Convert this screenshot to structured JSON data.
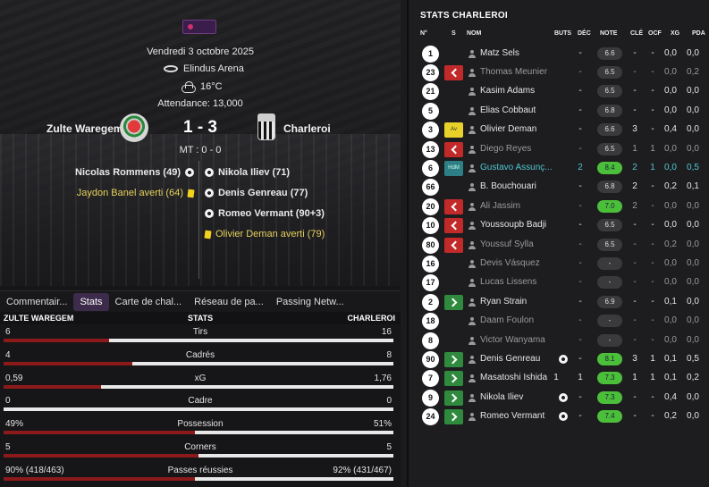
{
  "match": {
    "date": "Vendredi 3 octobre 2025",
    "stadium": "Elindus Arena",
    "weather": "16°C",
    "attendance": "Attendance: 13,000",
    "home_team": "Zulte Waregem",
    "away_team": "Charleroi",
    "score": "1 - 3",
    "halftime": "MT : 0 - 0"
  },
  "events": {
    "home": [
      {
        "text": "Nicolas Rommens (49)",
        "icon": "ball-icon"
      },
      {
        "text": "Jaydon Banel averti (64)",
        "icon": "yellow-card-icon"
      }
    ],
    "away": [
      {
        "text": "Nikola Iliev (71)",
        "icon": "ball-icon"
      },
      {
        "text": "Denis Genreau (77)",
        "icon": "ball-icon"
      },
      {
        "text": "Romeo Vermant (90+3)",
        "icon": "ball-icon"
      },
      {
        "text": "Olivier Deman averti (79)",
        "icon": "yellow-card-icon"
      }
    ]
  },
  "tabs": [
    "Commentair...",
    "Stats",
    "Carte de chal...",
    "Réseau de pa...",
    "Passing Netw..."
  ],
  "active_tab": "Stats",
  "stats": {
    "home_label": "ZULTE WAREGEM",
    "center_label": "STATS",
    "away_label": "CHARLEROI",
    "rows": [
      {
        "label": "Tirs",
        "home": "6",
        "away": "16",
        "home_share": 0.27
      },
      {
        "label": "Cadrés",
        "home": "4",
        "away": "8",
        "home_share": 0.33
      },
      {
        "label": "xG",
        "home": "0,59",
        "away": "1,76",
        "home_share": 0.25
      },
      {
        "label": "Cadre",
        "home": "0",
        "away": "0",
        "home_share": 0.0
      },
      {
        "label": "Possession",
        "home": "49%",
        "away": "51%",
        "home_share": 0.49
      },
      {
        "label": "Corners",
        "home": "5",
        "away": "5",
        "home_share": 0.5
      },
      {
        "label": "Passes réussies",
        "home": "90% (418/463)",
        "away": "92% (431/467)",
        "home_share": 0.49
      }
    ]
  },
  "squad": {
    "title": "STATS CHARLEROI",
    "columns": {
      "num": "N°",
      "s": "S",
      "name": "NOM",
      "buts": "BUTS",
      "dec": "DÉC",
      "note": "NOTE",
      "cle": "CLÉ",
      "ocf": "OCF",
      "xg": "XG",
      "pda": "PDA"
    },
    "players": [
      {
        "num": "1",
        "status": "",
        "name": "Matz Sels",
        "dim": false,
        "buts": "",
        "dec": "-",
        "note": "6.6",
        "green": false,
        "cle": "-",
        "ocf": "-",
        "xg": "0,0",
        "pda": "0,0",
        "goal": false
      },
      {
        "num": "23",
        "status": "out",
        "name": "Thomas Meunier",
        "dim": true,
        "buts": "",
        "dec": "-",
        "note": "6.5",
        "green": false,
        "cle": "-",
        "ocf": "-",
        "xg": "0,0",
        "pda": "0,2",
        "goal": false
      },
      {
        "num": "21",
        "status": "",
        "name": "Kasim Adams",
        "dim": false,
        "buts": "",
        "dec": "-",
        "note": "6.5",
        "green": false,
        "cle": "-",
        "ocf": "-",
        "xg": "0,0",
        "pda": "0,0",
        "goal": false
      },
      {
        "num": "5",
        "status": "",
        "name": "Elias Cobbaut",
        "dim": false,
        "buts": "",
        "dec": "-",
        "note": "6.8",
        "green": false,
        "cle": "-",
        "ocf": "-",
        "xg": "0,0",
        "pda": "0,0",
        "goal": false
      },
      {
        "num": "3",
        "status": "av",
        "status_text": "Av",
        "name": "Olivier Deman",
        "dim": false,
        "buts": "",
        "dec": "-",
        "note": "6.6",
        "green": false,
        "cle": "3",
        "ocf": "-",
        "xg": "0,4",
        "pda": "0,0",
        "goal": false
      },
      {
        "num": "13",
        "status": "out",
        "name": "Diego Reyes",
        "dim": true,
        "buts": "",
        "dec": "-",
        "note": "6.5",
        "green": false,
        "cle": "1",
        "ocf": "1",
        "xg": "0,0",
        "pda": "0,0",
        "goal": false
      },
      {
        "num": "6",
        "status": "hdm",
        "status_text": "HdM",
        "name": "Gustavo Assunç...",
        "hl": true,
        "buts": "",
        "dec": "2",
        "note": "8.4",
        "green": true,
        "cle": "2",
        "ocf": "1",
        "xg": "0,0",
        "pda": "0,5",
        "goal": false
      },
      {
        "num": "66",
        "status": "",
        "name": "B. Bouchouari",
        "dim": false,
        "buts": "",
        "dec": "-",
        "note": "6.8",
        "green": false,
        "cle": "2",
        "ocf": "-",
        "xg": "0,2",
        "pda": "0,1",
        "goal": false
      },
      {
        "num": "20",
        "status": "out",
        "name": "Ali Jassim",
        "dim": true,
        "buts": "",
        "dec": "-",
        "note": "7.0",
        "green": true,
        "cle": "2",
        "ocf": "-",
        "xg": "0,0",
        "pda": "0,0",
        "goal": false
      },
      {
        "num": "10",
        "status": "out",
        "name": "Youssoupb Badji",
        "dim": false,
        "buts": "",
        "dec": "-",
        "note": "6.5",
        "green": false,
        "cle": "-",
        "ocf": "-",
        "xg": "0,0",
        "pda": "0,0",
        "goal": false
      },
      {
        "num": "80",
        "status": "out",
        "name": "Youssuf Sylla",
        "dim": true,
        "buts": "",
        "dec": "-",
        "note": "6.5",
        "green": false,
        "cle": "-",
        "ocf": "-",
        "xg": "0,2",
        "pda": "0,0",
        "goal": false
      },
      {
        "num": "16",
        "status": "",
        "name": "Devis Vásquez",
        "dim": true,
        "buts": "",
        "dec": "-",
        "note": "-",
        "green": false,
        "cle": "-",
        "ocf": "-",
        "xg": "0,0",
        "pda": "0,0",
        "goal": false
      },
      {
        "num": "17",
        "status": "",
        "name": "Lucas Lissens",
        "dim": true,
        "buts": "",
        "dec": "-",
        "note": "-",
        "green": false,
        "cle": "-",
        "ocf": "-",
        "xg": "0,0",
        "pda": "0,0",
        "goal": false
      },
      {
        "num": "2",
        "status": "in",
        "name": "Ryan Strain",
        "dim": false,
        "buts": "",
        "dec": "-",
        "note": "6.9",
        "green": false,
        "cle": "-",
        "ocf": "-",
        "xg": "0,1",
        "pda": "0,0",
        "goal": false
      },
      {
        "num": "18",
        "status": "",
        "name": "Daam Foulon",
        "dim": true,
        "buts": "",
        "dec": "-",
        "note": "-",
        "green": false,
        "cle": "-",
        "ocf": "-",
        "xg": "0,0",
        "pda": "0,0",
        "goal": false
      },
      {
        "num": "8",
        "status": "",
        "name": "Victor Wanyama",
        "dim": true,
        "buts": "",
        "dec": "-",
        "note": "-",
        "green": false,
        "cle": "-",
        "ocf": "-",
        "xg": "0,0",
        "pda": "0,0",
        "goal": false
      },
      {
        "num": "90",
        "status": "in",
        "name": "Denis Genreau",
        "dim": false,
        "buts": "",
        "dec": "-",
        "note": "8.1",
        "green": true,
        "cle": "3",
        "ocf": "1",
        "xg": "0,1",
        "pda": "0,5",
        "goal": true
      },
      {
        "num": "7",
        "status": "in",
        "name": "Masatoshi Ishida",
        "dim": false,
        "buts": "1",
        "dec": "1",
        "note": "7.3",
        "green": true,
        "cle": "1",
        "ocf": "1",
        "xg": "0,1",
        "pda": "0,2",
        "goal": false
      },
      {
        "num": "9",
        "status": "in",
        "name": "Nikola Iliev",
        "dim": false,
        "buts": "",
        "dec": "-",
        "note": "7.3",
        "green": true,
        "cle": "-",
        "ocf": "-",
        "xg": "0,4",
        "pda": "0,0",
        "goal": true
      },
      {
        "num": "24",
        "status": "in",
        "name": "Romeo Vermant",
        "dim": false,
        "buts": "",
        "dec": "-",
        "note": "7.4",
        "green": true,
        "cle": "-",
        "ocf": "-",
        "xg": "0,2",
        "pda": "0,0",
        "goal": true
      }
    ]
  }
}
